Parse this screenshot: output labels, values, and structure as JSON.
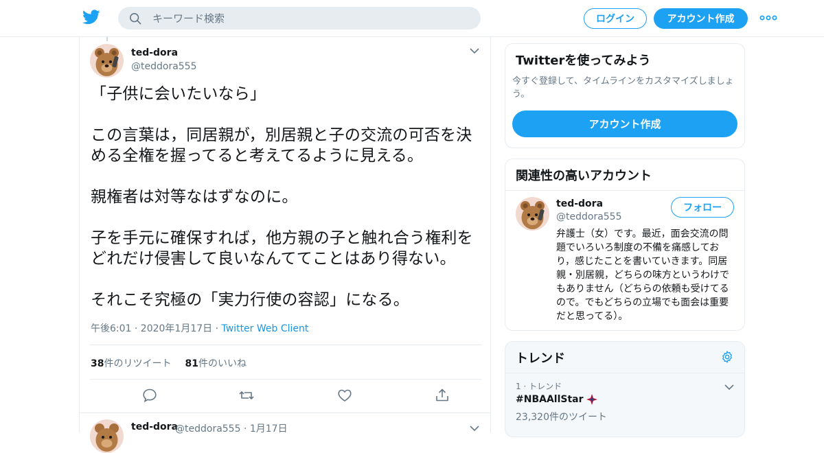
{
  "header": {
    "logo_icon": "twitter-bird-icon",
    "search_placeholder": "キーワード検索",
    "login_label": "ログイン",
    "signup_label": "アカウント作成",
    "more_icon": "more-dots-icon"
  },
  "colors": {
    "brand": "#1da1f2",
    "link": "#1b95e0",
    "muted": "#657786",
    "text": "#14171a",
    "border": "#e6ecf0"
  },
  "tweet": {
    "name": "ted-dora",
    "handle": "@teddora555",
    "text": "「子供に会いたいなら」\n\nこの言葉は，同居親が，別居親と子の交流の可否を決める全権を握ってると考えてるように見える。\n\n親権者は対等なはずなのに。\n\n子を手元に確保すれば，他方親の子と触れ合う権利をどれだけ侵害して良いなんててことはあり得ない。\n\nそれこそ究極の「実力行使の容認」になる。",
    "time": "午後6:01 · 2020年1月17日",
    "dot": "·",
    "client": "Twitter Web Client",
    "retweets_count": "38",
    "retweets_unit": "件の",
    "retweets_label": "リツイート",
    "likes_count": "81",
    "likes_unit": "件の",
    "likes_label": "いいね"
  },
  "next_tweet": {
    "name": "ted-dora",
    "handle_date": "@teddora555 · 1月17日"
  },
  "sidebar": {
    "join": {
      "title": "Twitterを使ってみよう",
      "desc": "今すぐ登録して、タイムラインをカスタマイズしましょう。",
      "cta": "アカウント作成"
    },
    "related": {
      "title": "関連性の高いアカウント",
      "name": "ted-dora",
      "handle": "@teddora555",
      "follow_label": "フォロー",
      "bio": "弁護士（女）です。最近，面会交流の問題でいろいろ制度の不備を痛感しており，感じたことを書いていきます。同居親・別居親，どちらの味方というわけでもありません（どちらの依頼も受けてるので。でもどちらの立場でも面会は重要だと思ってる）。"
    },
    "trends": {
      "title": "トレンド",
      "rank": "1 · トレンド",
      "name": "#NBAAllStar",
      "count": "23,320件のツイート"
    }
  }
}
